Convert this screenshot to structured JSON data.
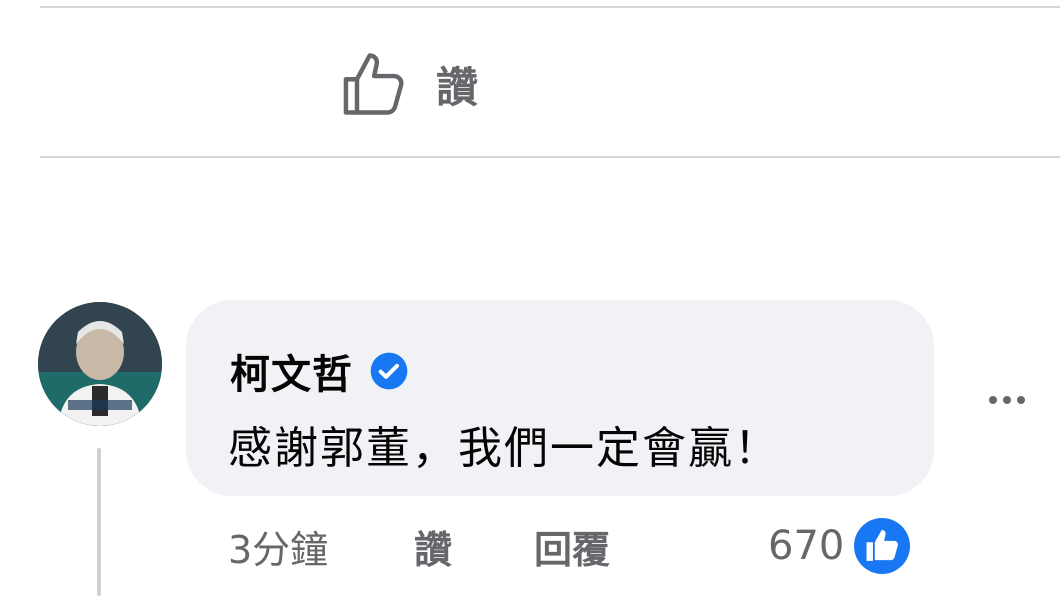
{
  "post_actions": {
    "like_label": "讚",
    "like_icon": "thumbs-up-outline-icon"
  },
  "comment": {
    "author": "柯文哲",
    "verified_icon": "verified-badge-icon",
    "text": "感謝郭董，我們一定會贏！",
    "timestamp": "3分鐘",
    "like_label": "讚",
    "reply_label": "回覆",
    "reaction_count": "670",
    "reaction_icon": "like-reaction-icon",
    "more_icon": "more-options-icon"
  },
  "colors": {
    "accent_blue": "#1877f2",
    "secondary_text": "#65676b",
    "bubble_bg": "#f0f2f5",
    "divider": "#d3d6db"
  }
}
